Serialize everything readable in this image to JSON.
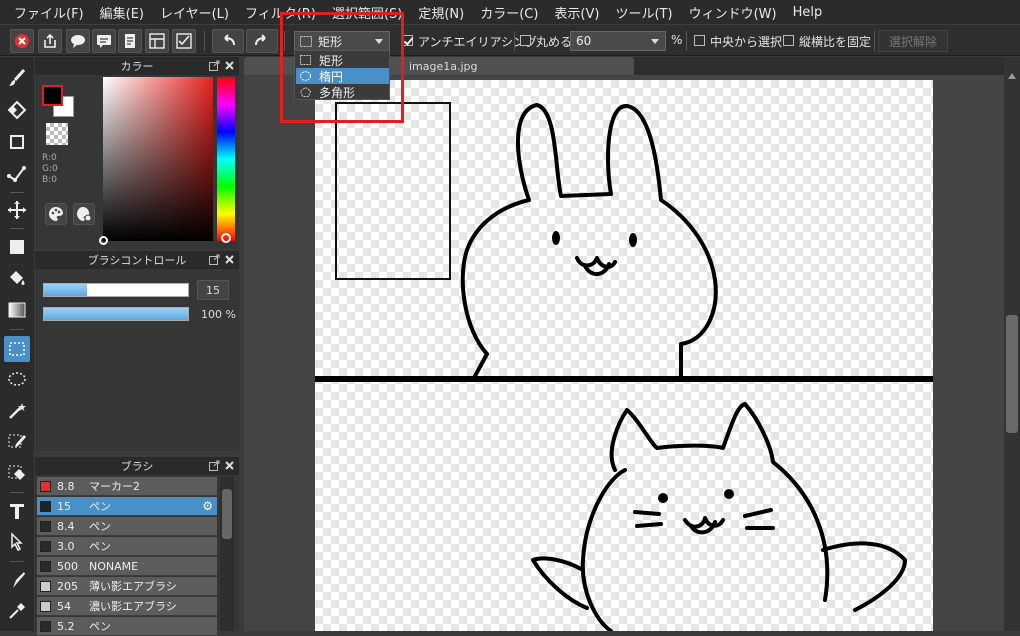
{
  "menu": [
    "ファイル(F)",
    "編集(E)",
    "レイヤー(L)",
    "フィルタ(R)",
    "選択範囲(S)",
    "定規(N)",
    "カラー(C)",
    "表示(V)",
    "ツール(T)",
    "ウィンドウ(W)",
    "Help"
  ],
  "toolbar": {
    "shape_select_value": "矩形",
    "antialias_label": "アンチエイリアシング",
    "antialias_checked": true,
    "round_label": "丸める",
    "round_checked": false,
    "round_value": "60",
    "percent": "%",
    "from_center_label": "中央から選択",
    "keep_ratio_label": "縦横比を固定",
    "deselect_label": "選択解除"
  },
  "dropdown": {
    "items": [
      {
        "label": "矩形",
        "icon": "rect-select-icon"
      },
      {
        "label": "楕円",
        "icon": "ellipse-select-icon",
        "selected": true
      },
      {
        "label": "多角形",
        "icon": "polygon-select-icon"
      }
    ]
  },
  "color_panel": {
    "title": "カラー",
    "r": "R:0",
    "g": "G:0",
    "b": "B:0",
    "foreground": "#000000",
    "background": "#ffffff"
  },
  "brush_control": {
    "title": "ブラシコントロール",
    "size_value": "15",
    "size_fraction": 0.3,
    "opacity_value": "100 %",
    "opacity_fraction": 1.0
  },
  "brush_panel": {
    "title": "ブラシ",
    "items": [
      {
        "size": "8.8",
        "name": "マーカー2",
        "color": "#e03030"
      },
      {
        "size": "15",
        "name": "ペン",
        "color": "#222222",
        "selected": true
      },
      {
        "size": "8.4",
        "name": "ペン",
        "color": "#2a2a2a"
      },
      {
        "size": "3.0",
        "name": "ペン",
        "color": "#2a2a2a"
      },
      {
        "size": "500",
        "name": "NONAME",
        "color": "#2a2a2a"
      },
      {
        "size": "205",
        "name": "薄い影エアブラシ",
        "color": "#cccccc"
      },
      {
        "size": "54",
        "name": "濃い影エアブラシ",
        "color": "#cccccc"
      },
      {
        "size": "5.2",
        "name": "ペン",
        "color": "#2a2a2a"
      }
    ]
  },
  "document": {
    "tab_title": "image1a.jpg"
  }
}
